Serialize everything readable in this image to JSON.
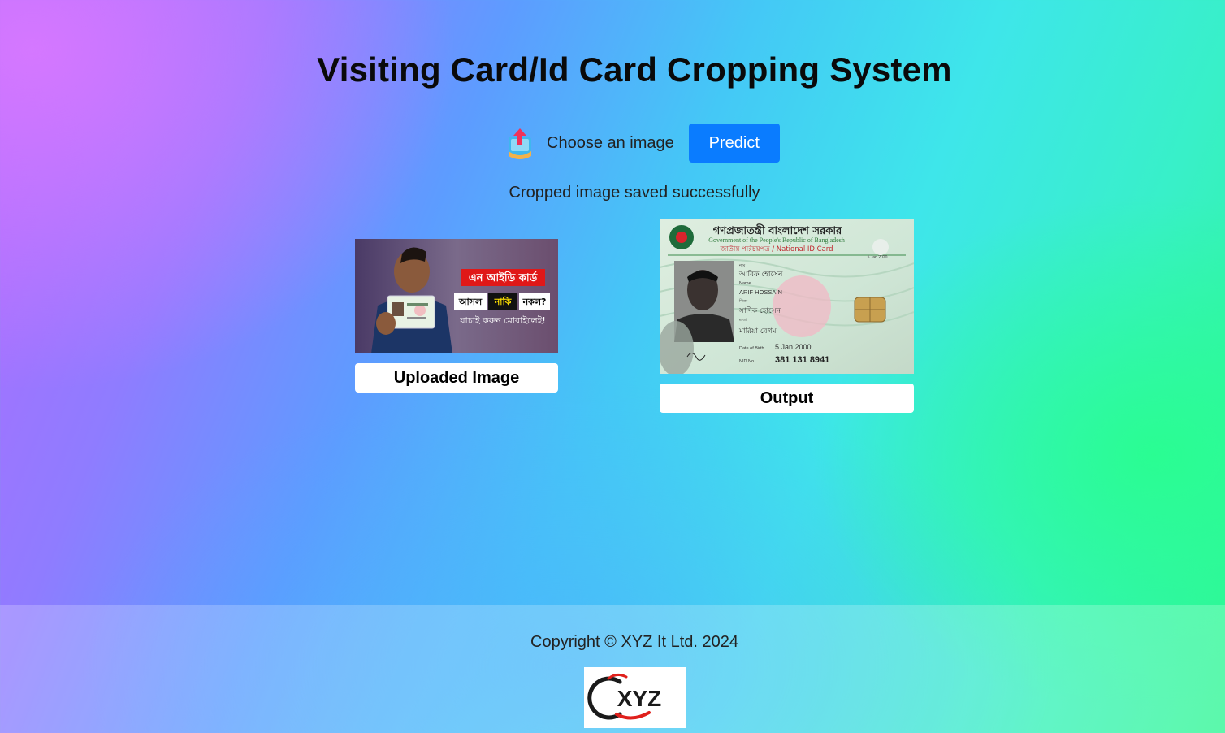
{
  "header": {
    "title": "Visiting Card/Id Card Cropping System"
  },
  "upload": {
    "choose_label": "Choose an image",
    "predict_label": "Predict",
    "icon": "upload-icon"
  },
  "status": {
    "message": "Cropped image saved successfully"
  },
  "uploaded": {
    "caption": "Uploaded Image",
    "banner_line1": "এন আইডি কার্ড",
    "banner_word1": "আসল",
    "banner_word2": "নাকি",
    "banner_word3": "নকল?",
    "banner_line3": "যাচাই করুন মোবাইলেই!"
  },
  "output": {
    "caption": "Output",
    "card_header_bn": "গণপ্রজাতন্ত্রী বাংলাদেশ সরকার",
    "card_header_en": "Government of the People's Republic of Bangladesh",
    "card_sub": "জাতীয় পরিচয়পত্র / National ID Card",
    "name_bn": "আরিফ হোসেন",
    "name_label": "Name",
    "name_en": "ARIF HOSSAIN",
    "father_bn": "সাদিক হোসেন",
    "mother_bn": "মারিয়া বেগম",
    "dob_label": "Date of Birth",
    "dob": "5 Jan 2000",
    "nid_label": "NID No.",
    "nid": "381 131 8941",
    "issue_date": "5 Jan 2020"
  },
  "footer": {
    "copyright": "Copyright © XYZ It Ltd. 2024",
    "logo_text": "XYZ"
  },
  "colors": {
    "predict_bg": "#0a7cff",
    "text": "#222222",
    "title": "#0a0a0a",
    "logo_red": "#e0201c"
  }
}
